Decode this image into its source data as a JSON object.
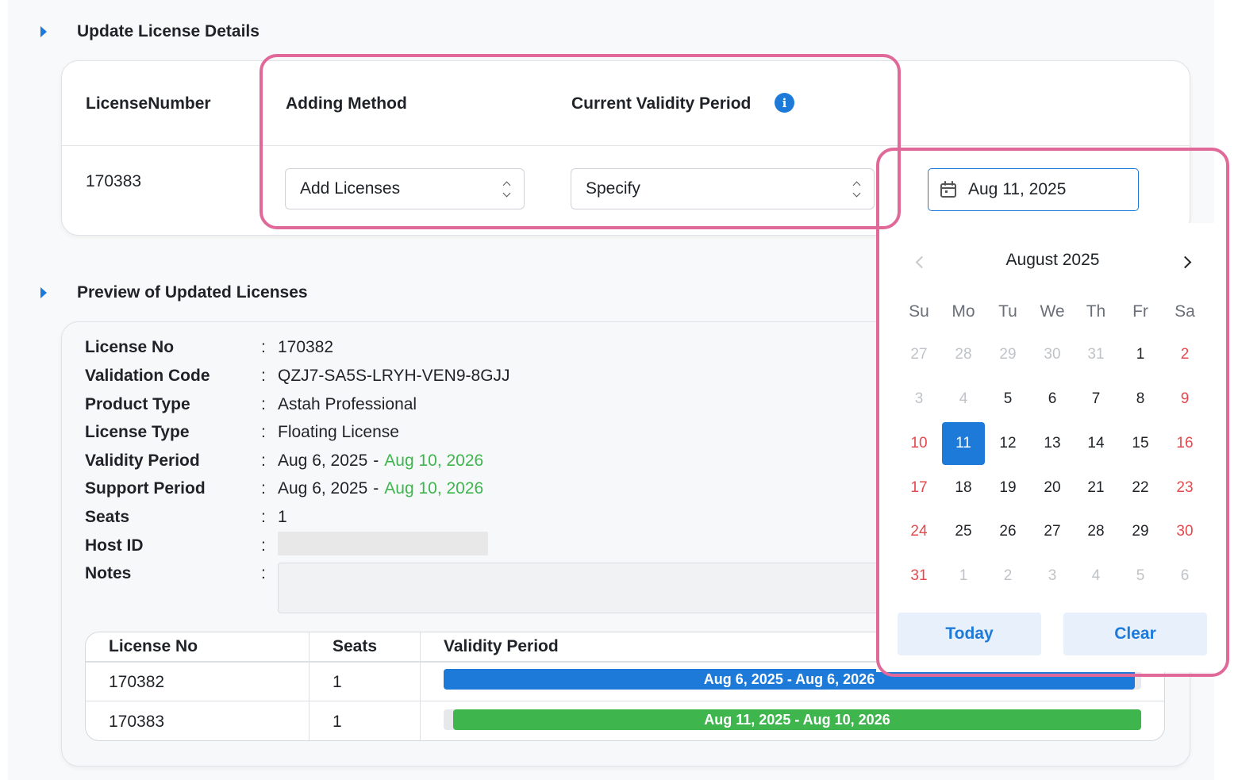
{
  "update_section": {
    "title": "Update License Details",
    "columns": {
      "license_number": "LicenseNumber",
      "adding_method": "Adding Method",
      "current_validity": "Current Validity Period"
    },
    "row": {
      "license_number": "170383",
      "adding_method_value": "Add Licenses",
      "validity_value": "Specify",
      "date_value": "Aug 11, 2025"
    }
  },
  "preview_section": {
    "title": "Preview of Updated Licenses",
    "details": [
      {
        "label": "License No",
        "value": "170382"
      },
      {
        "label": "Validation Code",
        "value": "QZJ7-SA5S-LRYH-VEN9-8GJJ"
      },
      {
        "label": "Product Type",
        "value": "Astah Professional"
      },
      {
        "label": "License Type",
        "value": "Floating License"
      },
      {
        "label": "Validity Period",
        "start": "Aug 6, 2025",
        "end": "Aug 10, 2026"
      },
      {
        "label": "Support Period",
        "start": "Aug 6, 2025",
        "end": "Aug 10, 2026"
      },
      {
        "label": "Seats",
        "value": "1"
      },
      {
        "label": "Host ID",
        "value": ""
      },
      {
        "label": "Notes",
        "value": ""
      }
    ],
    "colon": ":",
    "dash": "-",
    "table": {
      "headers": [
        "License No",
        "Seats",
        "Validity Period"
      ],
      "rows": [
        {
          "license_no": "170382",
          "seats": "1",
          "period": "Aug 6, 2025 - Aug 6, 2026",
          "color": "#1e7ad9"
        },
        {
          "license_no": "170383",
          "seats": "1",
          "period": "Aug 11, 2025 - Aug 10, 2026",
          "color": "#3fb54e"
        }
      ]
    }
  },
  "calendar": {
    "month_label": "August 2025",
    "weekdays": [
      "Su",
      "Mo",
      "Tu",
      "We",
      "Th",
      "Fr",
      "Sa"
    ],
    "weeks": [
      [
        "27",
        "28",
        "29",
        "30",
        "31",
        "1",
        "2"
      ],
      [
        "3",
        "4",
        "5",
        "6",
        "7",
        "8",
        "9"
      ],
      [
        "10",
        "11",
        "12",
        "13",
        "14",
        "15",
        "16"
      ],
      [
        "17",
        "18",
        "19",
        "20",
        "21",
        "22",
        "23"
      ],
      [
        "24",
        "25",
        "26",
        "27",
        "28",
        "29",
        "30"
      ],
      [
        "31",
        "1",
        "2",
        "3",
        "4",
        "5",
        "6"
      ]
    ],
    "selected_day": "11",
    "today_label": "Today",
    "clear_label": "Clear",
    "colors": {
      "accent": "#1e7ad9",
      "weekend": "#e5484d",
      "muted": "#bfc3c8"
    }
  }
}
